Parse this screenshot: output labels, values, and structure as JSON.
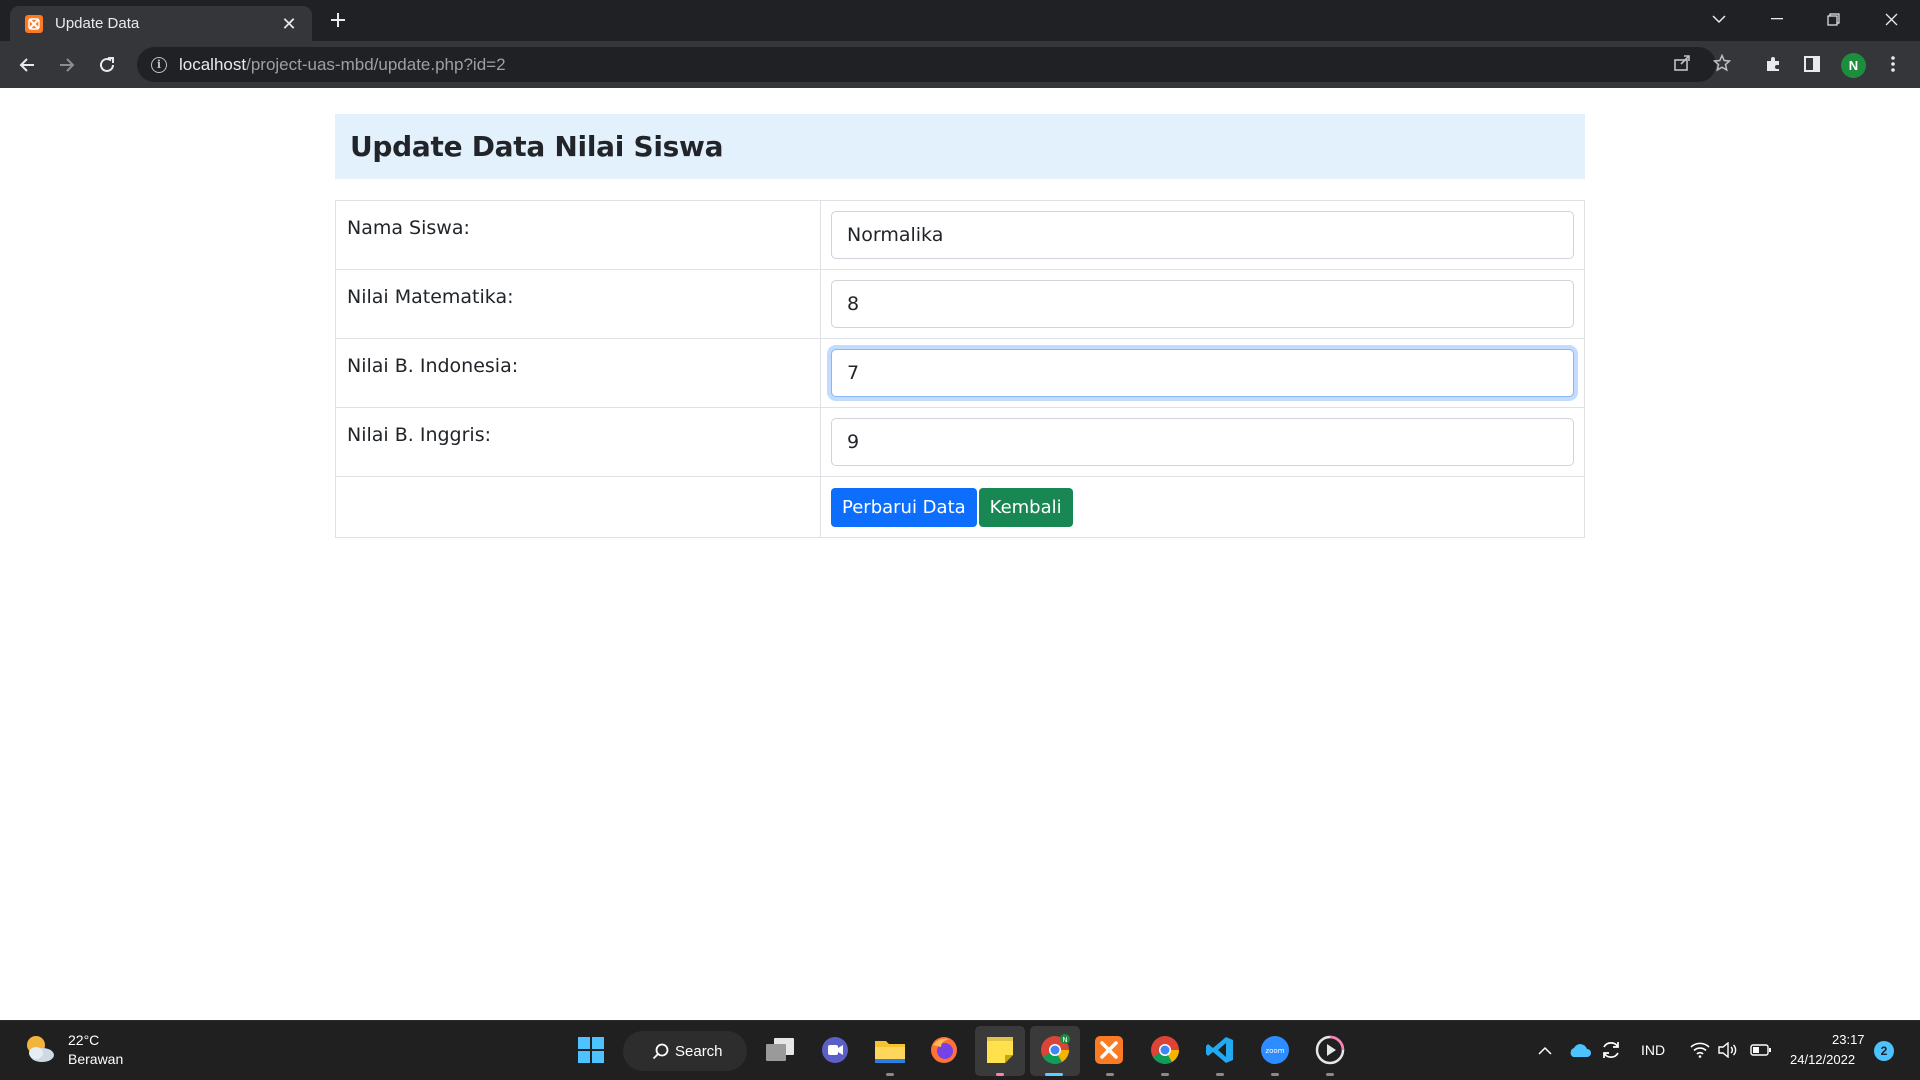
{
  "browser": {
    "tab_title": "Update Data",
    "tab_favicon": "xampp-icon",
    "url_host": "localhost",
    "url_path": "/project-uas-mbd/update.php?id=2",
    "profile_initial": "N"
  },
  "page": {
    "heading": "Update Data Nilai Siswa",
    "fields": [
      {
        "label": "Nama Siswa:",
        "value": "Normalika"
      },
      {
        "label": "Nilai Matematika:",
        "value": "8"
      },
      {
        "label": "Nilai B. Indonesia:",
        "value": "7"
      },
      {
        "label": "Nilai B. Inggris:",
        "value": "9"
      }
    ],
    "submit_label": "Perbarui Data",
    "back_label": "Kembali",
    "colors": {
      "header_bg": "#e3f1fc",
      "primary_button": "#0d6efd",
      "success_button": "#198754"
    }
  },
  "taskbar": {
    "weather_temp": "22°C",
    "weather_desc": "Berawan",
    "search_label": "Search",
    "language": "IND",
    "time": "23:17",
    "date": "24/12/2022",
    "notification_count": "2",
    "pinned_apps": [
      "start-icon",
      "search-icon",
      "task-view-icon",
      "teams-chat-icon",
      "file-explorer-icon",
      "firefox-icon",
      "sticky-notes-icon",
      "chrome-icon",
      "xampp-icon",
      "chrome-icon",
      "vscode-icon",
      "zoom-icon",
      "media-player-icon"
    ]
  }
}
